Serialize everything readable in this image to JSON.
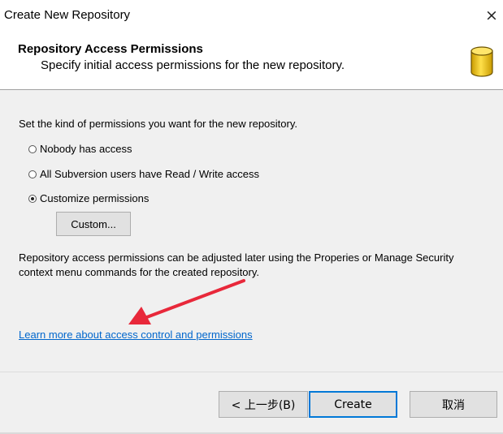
{
  "window": {
    "title": "Create New Repository",
    "close_icon": "×"
  },
  "header": {
    "title": "Repository Access Permissions",
    "subtitle": "Specify initial access permissions for the new repository.",
    "icon": "database-icon"
  },
  "content": {
    "intro": "Set the kind of permissions you want for the new repository.",
    "options": [
      {
        "label": "Nobody has access",
        "checked": false
      },
      {
        "label": "All Subversion users have Read / Write access",
        "checked": false
      },
      {
        "label": "Customize permissions",
        "checked": true
      }
    ],
    "custom_button": "Custom...",
    "note": "Repository access permissions can be adjusted later using the Properies or Manage Security context menu commands for the created repository.",
    "link": "Learn more about access control and permissions"
  },
  "footer": {
    "back_button": "< 上一步(B)",
    "create_button": "Create",
    "cancel_button": "取消"
  },
  "colors": {
    "link": "#0066cc",
    "default_button_border": "#0078d7",
    "annotation_arrow": "#e8283a",
    "db_icon_fill": "#f5c518"
  }
}
